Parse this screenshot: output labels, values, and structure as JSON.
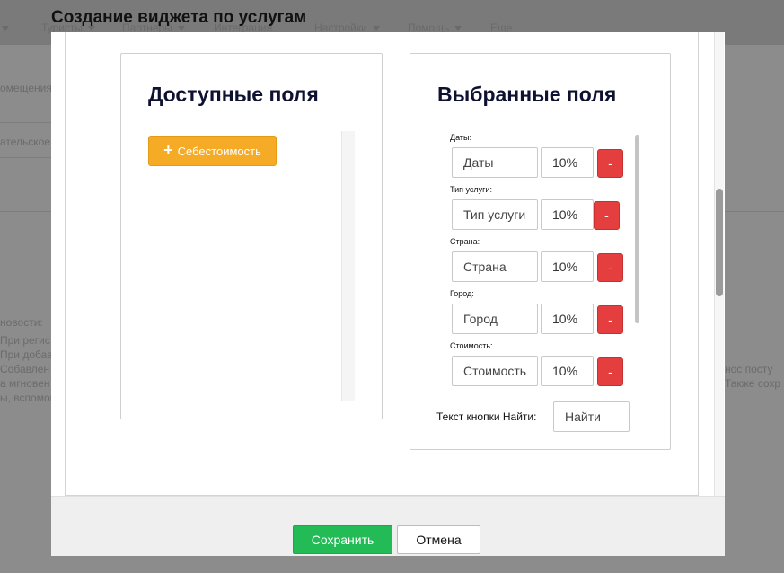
{
  "background": {
    "nav_items": [
      "Туристы",
      "Партнеры",
      "Интеграции",
      "Настройки",
      "Помощь",
      "Еще"
    ],
    "fragments": {
      "left_1": "омещения",
      "left_2": "ательское",
      "left_3": "новости:",
      "left_4": "При регис",
      "left_5": "При добав",
      "left_6": "Собавлен",
      "left_7": "а мгновен",
      "left_8": "ы, вспомог",
      "right_1": "нос посту",
      "right_2": "Также сохр"
    }
  },
  "modal": {
    "title": "Создание виджета по услугам",
    "available": {
      "title": "Доступные поля",
      "items": [
        {
          "label": "Себестоимость",
          "icon": "plus-icon"
        }
      ]
    },
    "selected": {
      "title": "Выбранные поля",
      "fields": [
        {
          "label": "Даты:",
          "value": "Даты",
          "width": "10%",
          "remove": "-"
        },
        {
          "label": "Тип услуги:",
          "value": "Тип услуги",
          "width": "10%",
          "remove": "-"
        },
        {
          "label": "Страна:",
          "value": "Страна",
          "width": "10%",
          "remove": "-"
        },
        {
          "label": "Город:",
          "value": "Город",
          "width": "10%",
          "remove": "-"
        },
        {
          "label": "Стоимость:",
          "value": "Стоимость",
          "width": "10%",
          "remove": "-"
        }
      ],
      "search_button_label": "Текст кнопки Найти:",
      "search_button_value": "Найти"
    },
    "footer": {
      "save": "Сохранить",
      "cancel": "Отмена"
    }
  },
  "colors": {
    "save": "#22bb55",
    "add": "#f5ab26",
    "remove": "#e53e3e",
    "title": "#0e1230"
  }
}
